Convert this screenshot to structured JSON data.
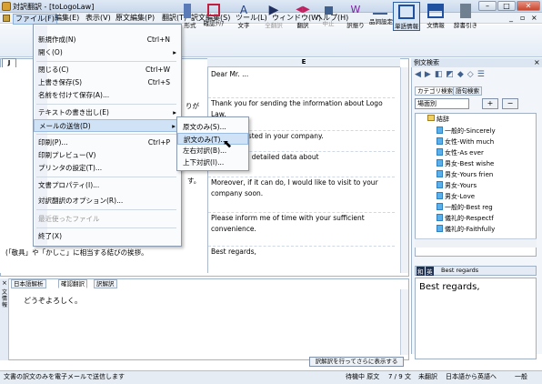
{
  "window": {
    "title": "対訳翻訳 - [toLogoLaw]"
  },
  "menubar": {
    "items": [
      "ファイル(F)",
      "編集(E)",
      "表示(V)",
      "原文編集(P)",
      "翻訳(T)",
      "訳文編集(S)",
      "ツール(L)",
      "ウィンドウ(W)",
      "ヘルプ(H)"
    ]
  },
  "toolbar": {
    "items": [
      "形式",
      "確認ｸﾘｱ",
      "文字",
      "全翻訳",
      "翻訳",
      "中止",
      "訳振り",
      "品詞設定",
      "単語情報",
      "文情報",
      "辞書引き"
    ]
  },
  "file_menu": {
    "items": [
      {
        "label": "新規作成(N)",
        "shortcut": "Ctrl+N",
        "arrow": ""
      },
      {
        "label": "開く(O)",
        "shortcut": "",
        "arrow": "▸"
      },
      {
        "label": "閉じる(C)",
        "shortcut": "Ctrl+W",
        "arrow": ""
      },
      {
        "label": "上書き保存(S)",
        "shortcut": "Ctrl+S",
        "arrow": ""
      },
      {
        "label": "名前を付けて保存(A)...",
        "shortcut": "",
        "arrow": ""
      },
      {
        "label": "テキストの書き出し(E)",
        "shortcut": "",
        "arrow": "▸"
      },
      {
        "label": "メールの送信(D)",
        "shortcut": "",
        "arrow": "▸"
      },
      {
        "label": "印刷(P)...",
        "shortcut": "Ctrl+P",
        "arrow": ""
      },
      {
        "label": "印刷プレビュー(V)",
        "shortcut": "",
        "arrow": ""
      },
      {
        "label": "プリンタの設定(T)...",
        "shortcut": "",
        "arrow": ""
      },
      {
        "label": "文書プロパティ(I)...",
        "shortcut": "",
        "arrow": ""
      },
      {
        "label": "対訳翻訳のオプション(R)...",
        "shortcut": "",
        "arrow": ""
      },
      {
        "label": "最近使ったファイル",
        "shortcut": "",
        "arrow": ""
      },
      {
        "label": "終了(X)",
        "shortcut": "",
        "arrow": ""
      }
    ]
  },
  "mail_submenu": {
    "items": [
      "原文のみ(S)...",
      "訳文のみ(T)...",
      "左右対訳(B)...",
      "上下対訳(I)..."
    ]
  },
  "editor": {
    "tab": "J",
    "target_header": "E",
    "source_fragments": [
      "りが",
      "す。"
    ],
    "source_last": "(「敬具」や「かしこ」に相当する結びの挨拶。",
    "target_rows": [
      "Dear Mr. ...",
      "Thank you for sending the information about Logo Law.",
      "I am interested in your company.",
      "I'll read the detailed data about",
      "Moreover, if it can do, I would like to visit to your company soon.",
      "Please inform me of time with your sufficient convenience.",
      "Best regards,"
    ]
  },
  "right_panel": {
    "title": "例文検索",
    "tabs": [
      "カテゴリ検索",
      "語句検索"
    ],
    "scene": "場面別",
    "tree_root": "結辞",
    "tree_items": [
      "一般的-Sincerely",
      "女性-With much",
      "女性-As ever",
      "男女-Best wishe",
      "男女-Yours frien",
      "男女-Yours",
      "男女-Love",
      "一般的-Best reg",
      "儀礼的-Respectf",
      "儀礼的-Faithfully"
    ],
    "lang_label": "Best regards",
    "preview_text": "Best regards,"
  },
  "bottom": {
    "tabs": [
      "日本語解析",
      "確認翻訳",
      "訳解訳"
    ],
    "side_label": "文情報",
    "text": "どうぞよろしく。",
    "action_button": "訳解訳を行ってさらに表示する"
  },
  "status": {
    "message": "文書の訳文のみを電子メールで送信します",
    "mode": "待機中 原文",
    "position": "7 / 9 文",
    "state": "未翻訳",
    "direction": "日本語から英語へ",
    "style": "一般"
  }
}
